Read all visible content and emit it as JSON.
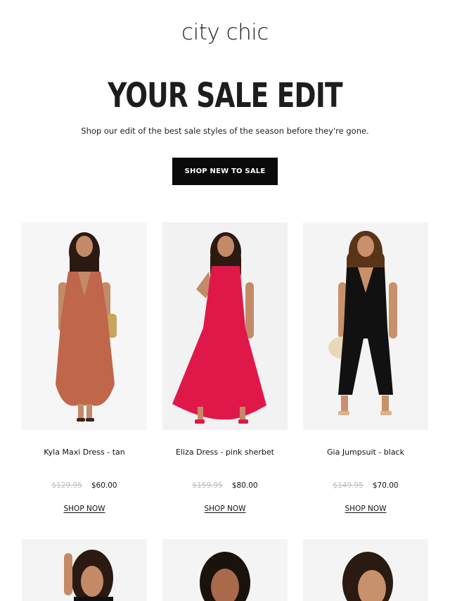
{
  "brand": {
    "logo_text": "city chic"
  },
  "hero": {
    "title": "YOUR SALE EDIT",
    "subtitle": "Shop our edit of the best sale styles of the season before they're gone.",
    "cta_label": "SHOP NEW TO SALE"
  },
  "products": [
    {
      "name": "Kyla Maxi Dress - tan",
      "was": "$129.95",
      "now": "$60.00",
      "cta": "SHOP NOW",
      "color": "#c0664a"
    },
    {
      "name": "Eliza Dress - pink sherbet",
      "was": "$159.95",
      "now": "$80.00",
      "cta": "SHOP NOW",
      "color": "#e0184a"
    },
    {
      "name": "Gia Jumpsuit - black",
      "was": "$149.95",
      "now": "$70.00",
      "cta": "SHOP NOW",
      "color": "#111111"
    }
  ],
  "colors": {
    "cta_bg": "#0a0a0a",
    "skin": "#c48a68",
    "hair": "#2b1a12",
    "image_bg": "#f4f4f4"
  }
}
